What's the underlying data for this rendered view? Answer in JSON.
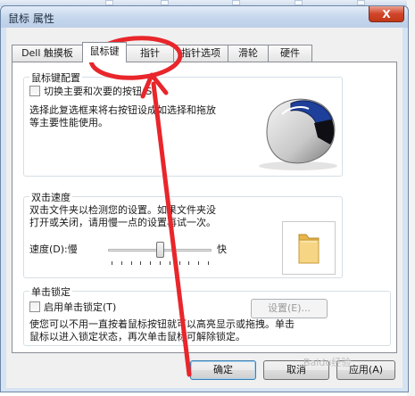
{
  "window": {
    "title": "鼠标 属性",
    "close_symbol": "X"
  },
  "tabs": [
    {
      "label": "Dell 触摸板",
      "active": false
    },
    {
      "label": "鼠标键",
      "active": true
    },
    {
      "label": "指针",
      "active": false
    },
    {
      "label": "指针选项",
      "active": false
    },
    {
      "label": "滑轮",
      "active": false
    },
    {
      "label": "硬件",
      "active": false
    }
  ],
  "button_config": {
    "title": "鼠标键配置",
    "checkbox_label": "切换主要和次要的按钮(S)",
    "checkbox_checked": false,
    "description": [
      "选择此复选框来将右按钮设成如选择和拖放",
      "等主要性能使用。"
    ]
  },
  "double_click": {
    "title": "双击速度",
    "description": [
      "双击文件夹以检测您的设置。如果文件夹没",
      "打开或关闭，请用慢一点的设置再试一次。"
    ],
    "speed_label": "速度(D):",
    "slow_label": "慢",
    "fast_label": "快",
    "speed_value_fraction": 0.5,
    "folder_icon": "folder-icon"
  },
  "click_lock": {
    "title": "单击锁定",
    "checkbox_label": "启用单击锁定(T)",
    "checkbox_checked": false,
    "settings_button": "设置(E)...",
    "description": [
      "使您可以不用一直按着鼠标按钮就可以高亮显示或拖拽。单击",
      "鼠标以进入锁定状态，再次单击鼠标可解除锁定。"
    ]
  },
  "footer": {
    "ok": "确定",
    "cancel": "取消",
    "apply": "应用(A)"
  },
  "watermark": "Baidu经验",
  "colors": {
    "annotation_red": "#e8262b",
    "close_red": "#c13717",
    "title_bar": "#c4d6ec"
  }
}
